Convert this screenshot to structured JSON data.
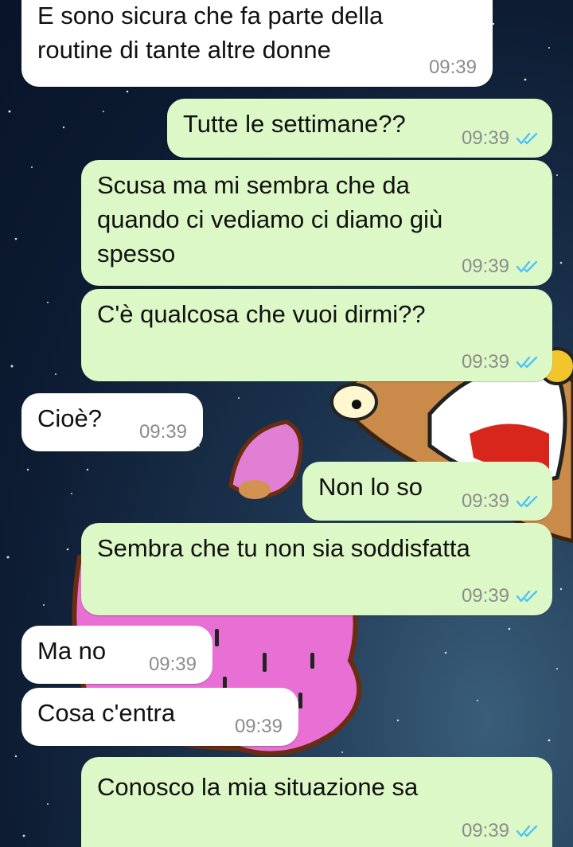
{
  "colors": {
    "incoming_bubble": "#ffffff",
    "outgoing_bubble": "#dcf8c6",
    "read_ticks": "#4fc3f7",
    "timestamp": "#8c8c8c"
  },
  "icons": {
    "read_receipt": "double-check-icon"
  },
  "messages": [
    {
      "direction": "incoming",
      "text": "E sono sicura che fa parte della\nroutine di tante altre donne",
      "time": "09:39"
    },
    {
      "direction": "outgoing",
      "text": "Tutte le settimane??",
      "time": "09:39",
      "status": "read"
    },
    {
      "direction": "outgoing",
      "text": "Scusa ma mi sembra che da\nquando ci vediamo ci diamo giù\nspesso",
      "time": "09:39",
      "status": "read"
    },
    {
      "direction": "outgoing",
      "text": "C'è qualcosa che vuoi dirmi??",
      "time": "09:39",
      "status": "read"
    },
    {
      "direction": "incoming",
      "text": "Cioè?",
      "time": "09:39"
    },
    {
      "direction": "outgoing",
      "text": "Non lo so",
      "time": "09:39",
      "status": "read"
    },
    {
      "direction": "outgoing",
      "text": "Sembra che tu non sia soddisfatta",
      "time": "09:39",
      "status": "read"
    },
    {
      "direction": "incoming",
      "text": "Ma no",
      "time": "09:39"
    },
    {
      "direction": "incoming",
      "text": "Cosa c'entra",
      "time": "09:39"
    },
    {
      "direction": "outgoing",
      "text": "Conosco la mia situazione sa",
      "time": "09:39",
      "status": "read"
    }
  ]
}
